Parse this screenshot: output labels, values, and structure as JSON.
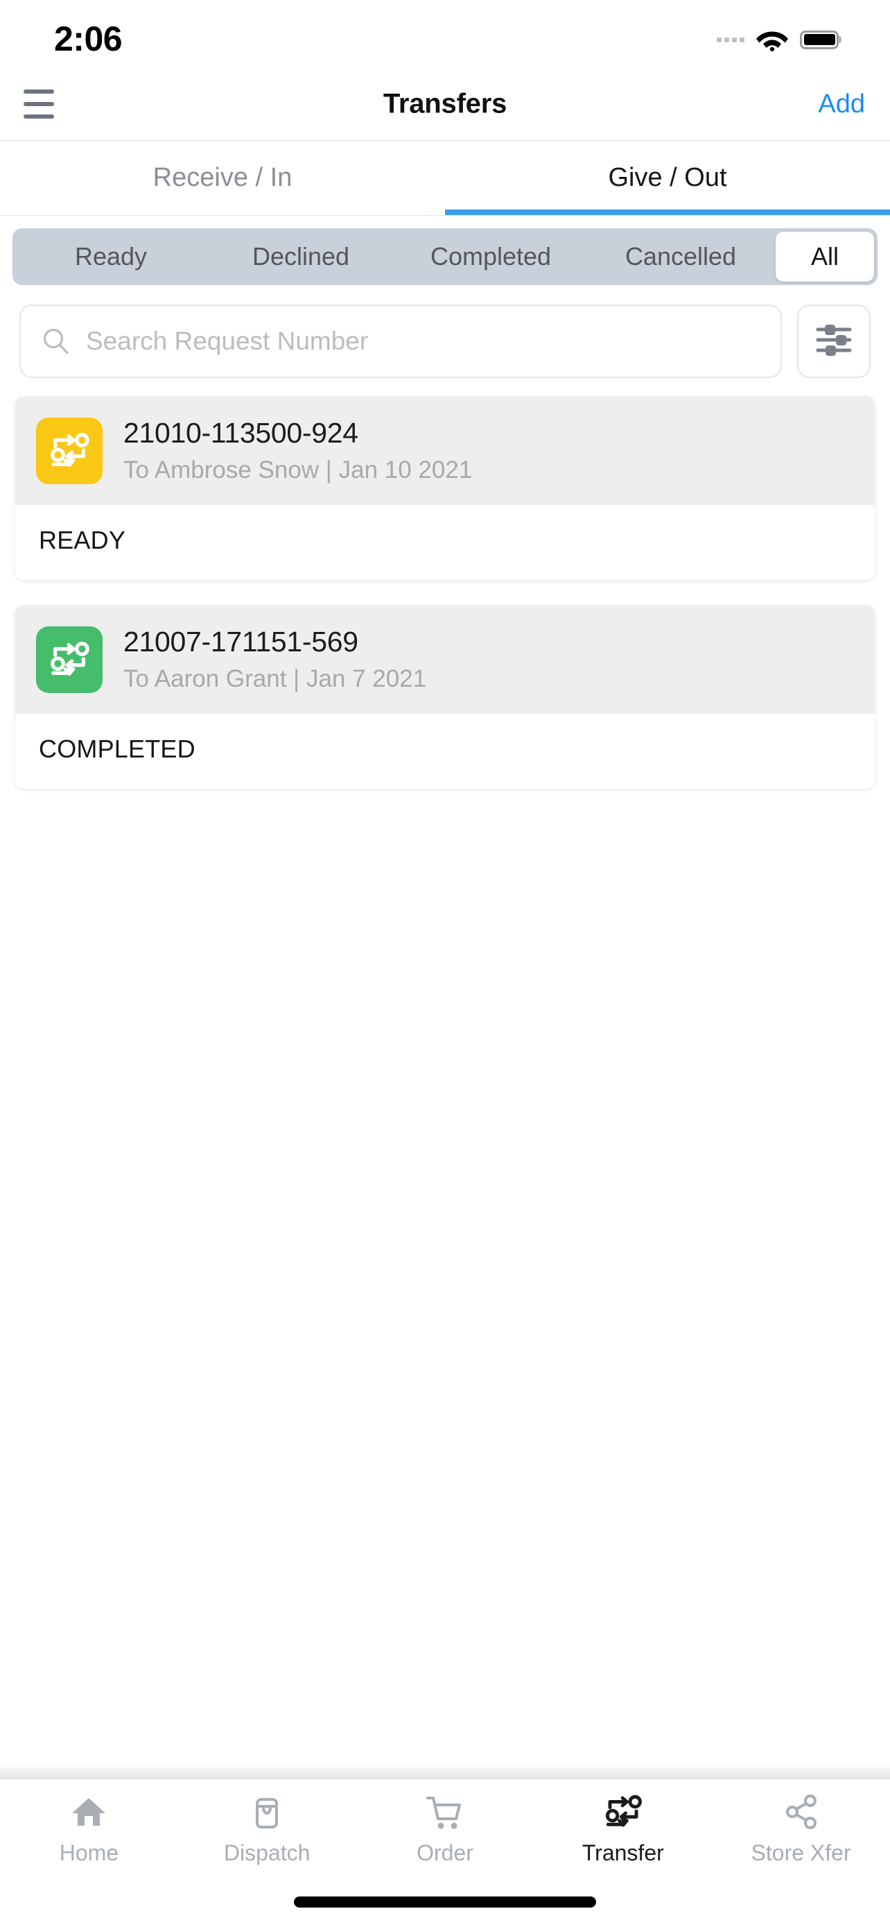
{
  "status_bar": {
    "time": "2:06",
    "signal_icon": "signal-dots-icon",
    "wifi_icon": "wifi-icon",
    "battery_icon": "battery-full-icon"
  },
  "nav_bar": {
    "menu_icon": "hamburger-menu-icon",
    "title": "Transfers",
    "add_label": "Add"
  },
  "tabs": {
    "items": [
      {
        "label": "Receive / In",
        "active": false
      },
      {
        "label": "Give / Out",
        "active": true
      }
    ],
    "indicator_color": "#3d9ded"
  },
  "filters": {
    "items": [
      {
        "label": "Ready",
        "active": false
      },
      {
        "label": "Declined",
        "active": false
      },
      {
        "label": "Completed",
        "active": false
      },
      {
        "label": "Cancelled",
        "active": false
      },
      {
        "label": "All",
        "active": true
      }
    ],
    "track_color": "#c8d0da",
    "active_color": "#ffffff"
  },
  "search": {
    "placeholder": "Search Request Number",
    "value": "",
    "icon": "search-icon",
    "filter_button_icon": "sliders-filter-icon"
  },
  "transfers": [
    {
      "id": "21010-113500-924",
      "subtitle": "To Ambrose Snow | Jan 10 2021",
      "status": "READY",
      "badge_color": "#fac815",
      "badge_icon": "transfer-icon"
    },
    {
      "id": "21007-171151-569",
      "subtitle": "To Aaron Grant | Jan 7 2021",
      "status": "COMPLETED",
      "badge_color": "#45bd6a",
      "badge_icon": "transfer-icon"
    }
  ],
  "bottom_nav": {
    "items": [
      {
        "label": "Home",
        "icon": "home-icon",
        "active": false
      },
      {
        "label": "Dispatch",
        "icon": "dispatch-bag-icon",
        "active": false
      },
      {
        "label": "Order",
        "icon": "shopping-cart-icon",
        "active": false
      },
      {
        "label": "Transfer",
        "icon": "transfer-icon",
        "active": true
      },
      {
        "label": "Store Xfer",
        "icon": "share-nodes-icon",
        "active": false
      }
    ],
    "inactive_color": "#a9adb4",
    "active_color": "#1b1b1f"
  },
  "home_indicator": {
    "name": "home-indicator"
  }
}
